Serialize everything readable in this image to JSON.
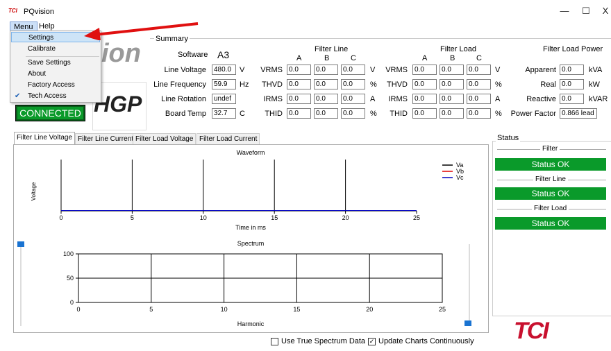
{
  "window": {
    "icon_text": "TCI",
    "title": "PQvision",
    "min": "—",
    "max": "☐",
    "close": "X"
  },
  "menubar": {
    "menu": "Menu",
    "help": "Help"
  },
  "dropdown": {
    "items": [
      "Settings",
      "Calibrate",
      "Save Settings",
      "About",
      "Factory Access",
      "Tech Access"
    ],
    "check": "✔"
  },
  "logo": {
    "fragment1": "ion",
    "fragment2": "HGP"
  },
  "connection": {
    "status": "CONNECTED"
  },
  "summary": {
    "title": "Summary",
    "software_label": "Software",
    "software_value": "A3",
    "line_voltage_label": "Line Voltage",
    "line_voltage": "480.0",
    "line_voltage_unit": "V",
    "line_freq_label": "Line Frequency",
    "line_freq": "59.9",
    "line_freq_unit": "Hz",
    "line_rot_label": "Line Rotation",
    "line_rot": "undef",
    "board_temp_label": "Board Temp",
    "board_temp": "32.7",
    "board_temp_unit": "C",
    "filter_line": {
      "title": "Filter Line",
      "cols": [
        "A",
        "B",
        "C"
      ],
      "rows": [
        {
          "label": "VRMS",
          "values": [
            "0.0",
            "0.0",
            "0.0"
          ],
          "unit": "V"
        },
        {
          "label": "THVD",
          "values": [
            "0.0",
            "0.0",
            "0.0"
          ],
          "unit": "%"
        },
        {
          "label": "IRMS",
          "values": [
            "0.0",
            "0.0",
            "0.0"
          ],
          "unit": "A"
        },
        {
          "label": "THID",
          "values": [
            "0.0",
            "0.0",
            "0.0"
          ],
          "unit": "%"
        }
      ]
    },
    "filter_load": {
      "title": "Filter Load",
      "cols": [
        "A",
        "B",
        "C"
      ],
      "rows": [
        {
          "label": "VRMS",
          "values": [
            "0.0",
            "0.0",
            "0.0"
          ],
          "unit": "V"
        },
        {
          "label": "THVD",
          "values": [
            "0.0",
            "0.0",
            "0.0"
          ],
          "unit": "%"
        },
        {
          "label": "IRMS",
          "values": [
            "0.0",
            "0.0",
            "0.0"
          ],
          "unit": "A"
        },
        {
          "label": "THID",
          "values": [
            "0.0",
            "0.0",
            "0.0"
          ],
          "unit": "%"
        }
      ]
    },
    "filter_load_power": {
      "title": "Filter Load Power",
      "rows": [
        {
          "label": "Apparent",
          "value": "0.0",
          "unit": "kVA"
        },
        {
          "label": "Real",
          "value": "0.0",
          "unit": "kW"
        },
        {
          "label": "Reactive",
          "value": "0.0",
          "unit": "kVAR"
        },
        {
          "label": "Power Factor",
          "value": "0.866 lead",
          "unit": ""
        }
      ]
    }
  },
  "tabs": [
    "Filter Line Voltage",
    "Filter Line Current",
    "Filter Load Voltage",
    "Filter Load Current"
  ],
  "chart_data": [
    {
      "type": "line",
      "title": "Waveform",
      "xlabel": "Time in ms",
      "ylabel": "Voltage",
      "xlim": [
        0,
        25
      ],
      "xticks": [
        "0",
        "5",
        "10",
        "15",
        "20",
        "25"
      ],
      "series": [
        {
          "name": "Va",
          "color": "#000000",
          "values": []
        },
        {
          "name": "Vb",
          "color": "#e00000",
          "values": []
        },
        {
          "name": "Vc",
          "color": "#0000c0",
          "values": []
        }
      ]
    },
    {
      "type": "bar",
      "title": "Spectrum",
      "xlabel": "Harmonic",
      "ylabel": "",
      "xlim": [
        0,
        25
      ],
      "ylim": [
        0,
        100
      ],
      "xticks": [
        "0",
        "5",
        "10",
        "15",
        "20",
        "25"
      ],
      "yticks": [
        "0",
        "50",
        "100"
      ],
      "values": []
    }
  ],
  "status": {
    "title": "Status",
    "sections": [
      {
        "label": "Filter",
        "value": "Status OK"
      },
      {
        "label": "Filter Line",
        "value": "Status OK"
      },
      {
        "label": "Filter Load",
        "value": "Status OK"
      }
    ],
    "ok_color": "#0a9a2a"
  },
  "options": {
    "use_true_spectrum": "Use True Spectrum Data",
    "use_true_spectrum_checked": false,
    "update_continuously": "Update Charts Continuously",
    "update_continuously_checked": true
  },
  "brand": {
    "logo": "TCI"
  }
}
